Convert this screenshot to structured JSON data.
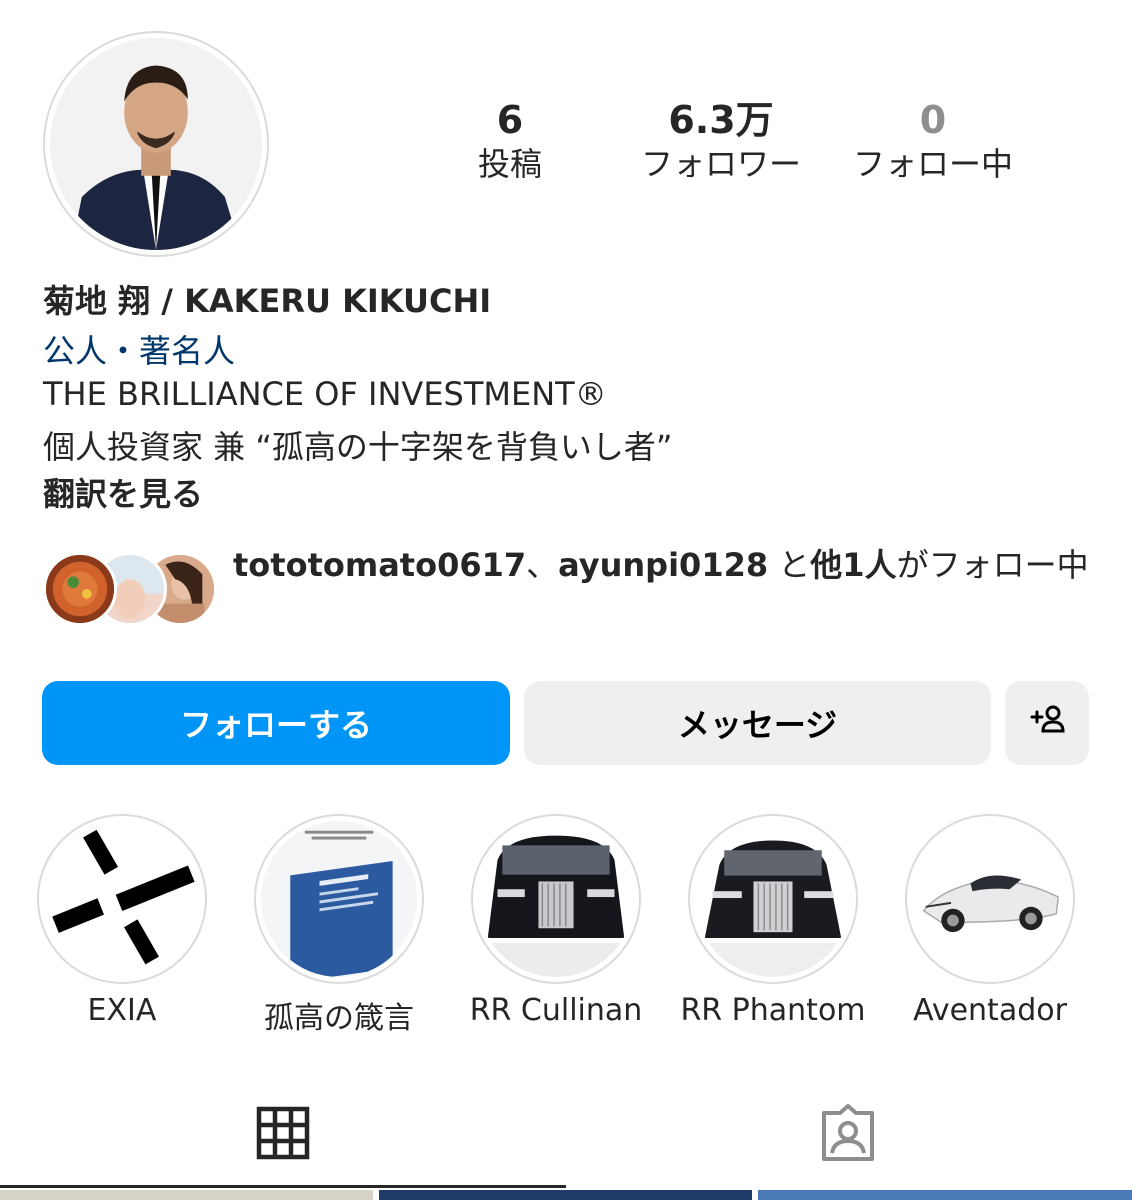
{
  "profile": {
    "stats": [
      {
        "value": "6",
        "label": "投稿",
        "muted": false
      },
      {
        "value": "6.3万",
        "label": "フォロワー",
        "muted": false
      },
      {
        "value": "0",
        "label": "フォロー中",
        "muted": true
      }
    ],
    "name": "菊地 翔 / KAKERU KIKUCHI",
    "category": "公人・著名人",
    "bio_line1": "THE BRILLIANCE OF INVESTMENT®",
    "bio_line2": "個人投資家 兼 “孤高の十字架を背負いし者”",
    "translate_link": "翻訳を見る"
  },
  "mutuals": {
    "user1": "tototomato0617",
    "sep": "、",
    "user2": "ayunpi0128",
    "mid": " と",
    "others": "他1人",
    "suffix": "がフォロー中"
  },
  "actions": {
    "follow_label": "フォローする",
    "message_label": "メッセージ",
    "add_user_icon": "person-plus-icon"
  },
  "highlights": [
    {
      "label": "EXIA"
    },
    {
      "label": "孤高の箴言"
    },
    {
      "label": "RR Cullinan"
    },
    {
      "label": "RR Phantom"
    },
    {
      "label": "Aventador"
    }
  ],
  "tabs": [
    {
      "icon": "grid-icon",
      "active": true
    },
    {
      "icon": "tagged-person-icon",
      "active": false
    }
  ],
  "colors": {
    "accent": "#0095f6",
    "link": "#00376b",
    "button_gray": "#efefef",
    "muted": "#8e8e8e"
  }
}
